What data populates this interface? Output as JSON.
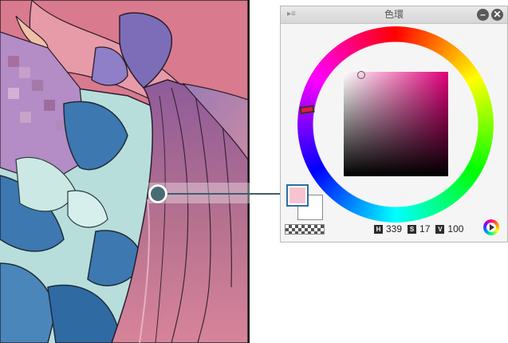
{
  "panel": {
    "title": "色環",
    "menu_icon": "panel-menu-icon",
    "minimize_icon": "minimize-icon",
    "close_icon": "close-icon",
    "close_glyph": "✕",
    "minimize_glyph": "–"
  },
  "colors": {
    "main_color": "#f6c4d0",
    "sub_color": "#ffffff",
    "hue_marker": "#e8164a",
    "accent_blue": "#2b6fa5",
    "callout": "#4a6a76"
  },
  "color_wheel": {
    "sv_cursor": {
      "s": 0.17,
      "v": 1.0
    }
  },
  "hsv": {
    "h_label": "H",
    "h_value": "339",
    "s_label": "S",
    "s_value": "17",
    "v_label": "V",
    "v_value": "100"
  },
  "icons": {
    "mode_switch": "hsv-mode-icon",
    "transparent_swatch": "transparent-color-icon"
  }
}
